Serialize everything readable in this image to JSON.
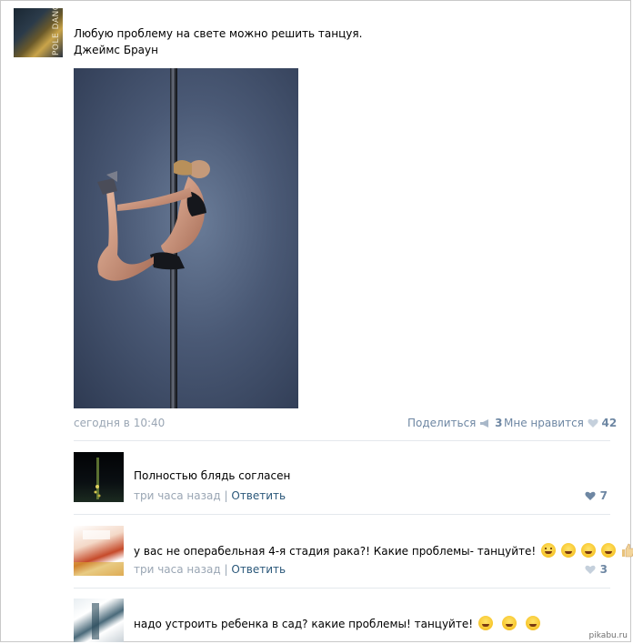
{
  "post": {
    "author_avatar_text": "POLE DANCE",
    "text_line1": "Любую проблему на свете можно решить танцуя.",
    "text_line2": "Джеймс Браун",
    "time": "сегодня в 10:40",
    "share_label": "Поделиться",
    "share_count": "3",
    "like_label": "Мне нравится",
    "like_count": "42"
  },
  "comments": [
    {
      "text": "Полностью блядь согласен",
      "time": "три часа назад",
      "separator": "|",
      "reply_label": "Ответить",
      "likes": "7"
    },
    {
      "text": "у вас не операбельная 4-я стадия рака?! Какие проблемы- танцуйте!",
      "time": "три часа назад",
      "separator": "|",
      "reply_label": "Ответить",
      "likes": "3"
    },
    {
      "text": "надо устроить ребенка в сад? какие проблемы! танцуйте!"
    }
  ],
  "watermark": "pikabu.ru",
  "colors": {
    "link": "#2b587a",
    "meta": "#9aa6b4",
    "action": "#6e87a3",
    "like_heart": "#6e87a3"
  }
}
